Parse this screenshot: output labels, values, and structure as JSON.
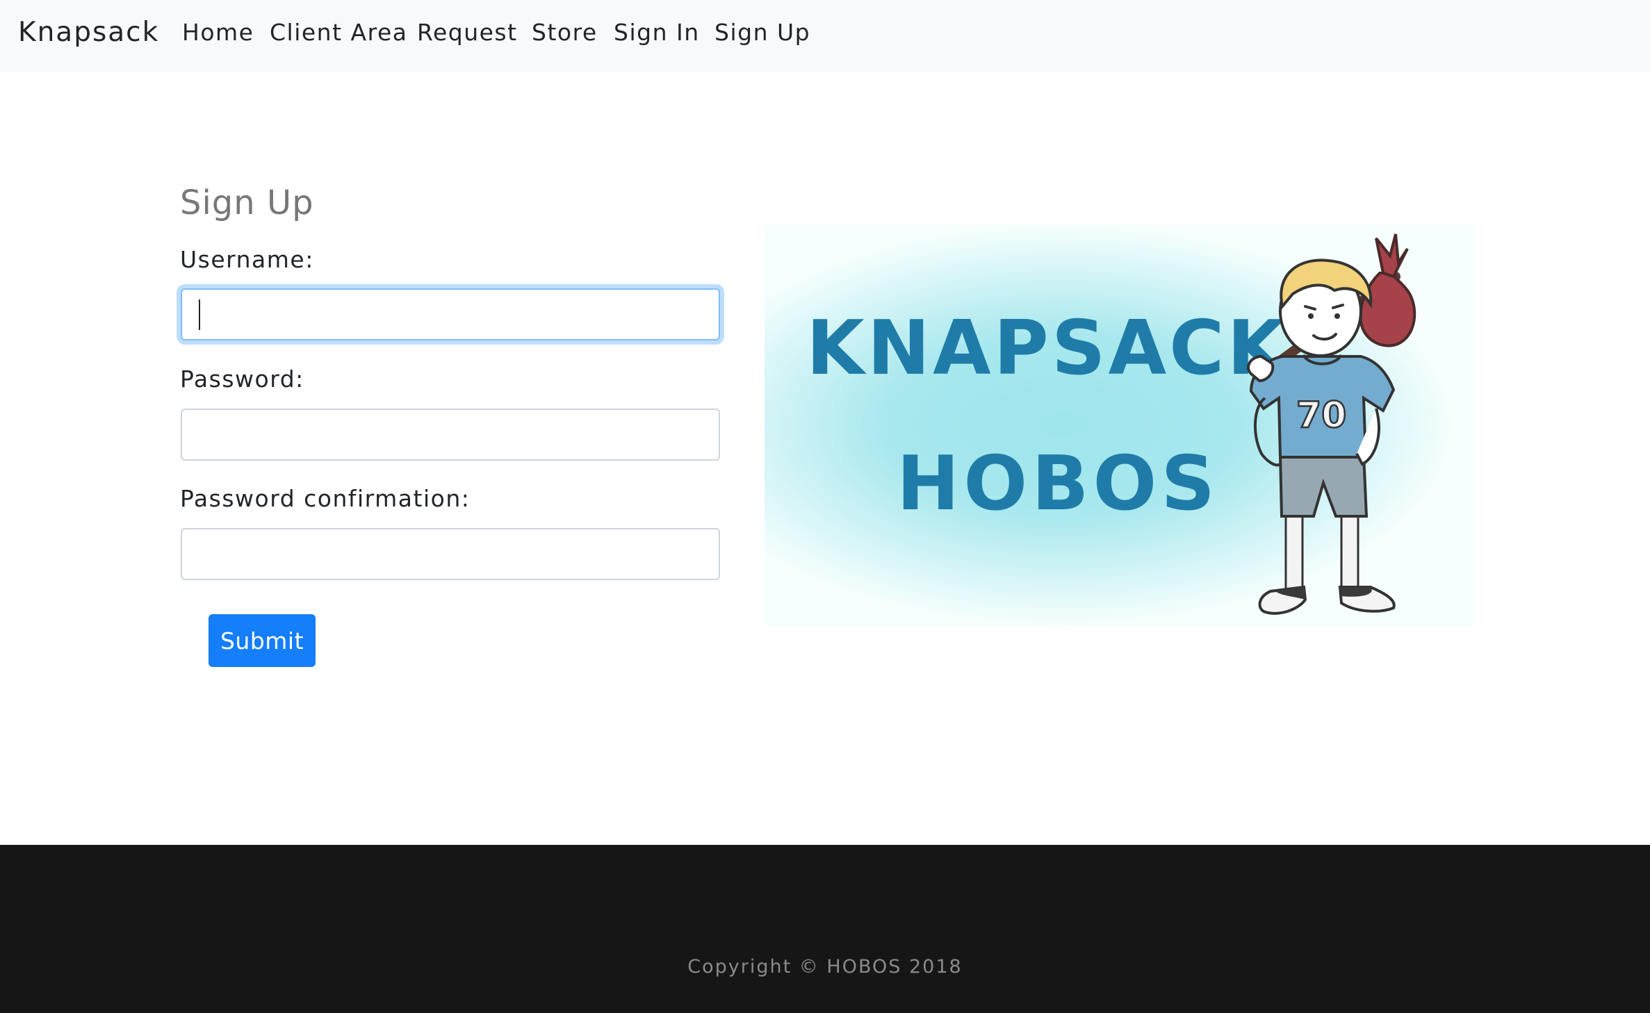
{
  "navbar": {
    "brand": "Knapsack",
    "links": [
      "Home",
      "Client Area",
      "Request",
      "Store",
      "Sign In",
      "Sign Up"
    ]
  },
  "form": {
    "title": "Sign Up",
    "username_label": "Username:",
    "username_value": "",
    "password_label": "Password:",
    "password_value": "",
    "confirm_label": "Password confirmation:",
    "confirm_value": "",
    "submit_label": "Submit"
  },
  "banner": {
    "line1": "KNAPSACK",
    "line2": "HOBOS",
    "jersey_number": "70"
  },
  "footer": {
    "copyright": "Copyright © HOBOS 2018"
  },
  "colors": {
    "primary": "#147efb",
    "navbar_bg": "#f8f9fa",
    "footer_bg": "#161616",
    "banner_text": "#1f7ca8"
  }
}
